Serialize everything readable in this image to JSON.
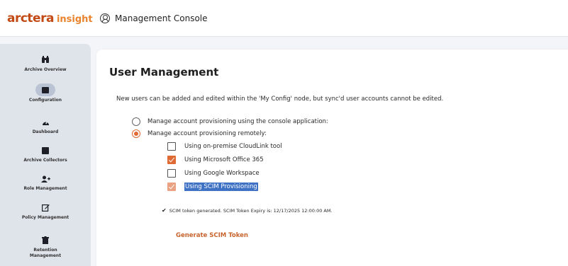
{
  "header": {
    "logo_brand": "arctera",
    "logo_product": "insight",
    "console_icon": "user-circle-icon",
    "title": "Management Console"
  },
  "sidebar": {
    "items": [
      {
        "label": "Archive Overview",
        "icon": "binoculars-icon",
        "glyph": "👁",
        "active": false
      },
      {
        "label": "Configuration",
        "icon": "config-icon",
        "glyph": "▪",
        "active": true
      },
      {
        "label": "Dashboard",
        "icon": "gauge-icon",
        "glyph": "◓",
        "active": false
      },
      {
        "label": "Archive Collectors",
        "icon": "collector-icon",
        "glyph": "▪",
        "active": false
      },
      {
        "label": "Role Management",
        "icon": "users-icon",
        "glyph": "👥",
        "active": false
      },
      {
        "label": "Policy Management",
        "icon": "edit-icon",
        "glyph": "✎",
        "active": false
      },
      {
        "label": "Retention",
        "icon": "trash-icon",
        "glyph": "▪",
        "active": false
      },
      {
        "label": "Management",
        "icon": "",
        "glyph": "",
        "active": false
      }
    ]
  },
  "main": {
    "title": "User Management",
    "description": "New users can be added and edited within the 'My Config' node, but sync'd user accounts cannot be edited.",
    "provisioning": {
      "options": [
        {
          "label": "Manage account provisioning using the console application:",
          "checked": false
        },
        {
          "label": "Manage account provisioning remotely:",
          "checked": true
        }
      ],
      "remote_methods": [
        {
          "label": "Using on-premise CloudLink tool",
          "checked": false
        },
        {
          "label": "Using Microsoft Office 365",
          "checked": true
        },
        {
          "label": "Using Google Workspace",
          "checked": false
        },
        {
          "label": "Using SCIM Provisioning",
          "checked": true
        }
      ]
    },
    "token_status": "SCIM token generated. SCIM Token Expiry is: 12/17/2025 12:00:00 AM.",
    "generate_button": "Generate SCIM Token"
  },
  "colors": {
    "accent": "#e06a33",
    "brand": "#c24a14",
    "selection": "#3f72c4",
    "sidebar_bg": "#dfe3ea"
  }
}
